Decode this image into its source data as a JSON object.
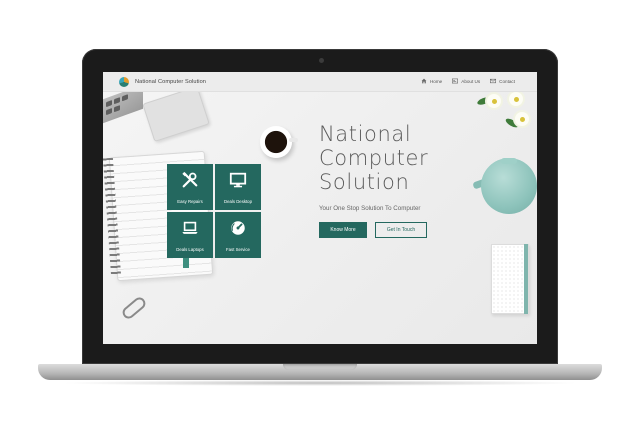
{
  "brand": {
    "name": "National Computer Solution"
  },
  "nav": {
    "items": [
      {
        "label": "Home",
        "icon": "home-icon"
      },
      {
        "label": "About Us",
        "icon": "id-card-icon"
      },
      {
        "label": "Contact",
        "icon": "envelope-icon"
      }
    ]
  },
  "services": [
    {
      "label": "Easy Repairs",
      "icon": "tools-icon"
    },
    {
      "label": "Deals Desktop",
      "icon": "monitor-icon"
    },
    {
      "label": "Deals Laptops",
      "icon": "laptop-icon"
    },
    {
      "label": "Fast Service",
      "icon": "gauge-icon"
    }
  ],
  "hero": {
    "title_lines": [
      "National",
      "Computer",
      "Solution"
    ],
    "subtitle": "Your One Stop Solution To Computer",
    "primary_button": "Know More",
    "secondary_button": "Get In Touch"
  },
  "colors": {
    "accent": "#24685f",
    "background": "#eeeeee",
    "navbar": "#ececec"
  }
}
